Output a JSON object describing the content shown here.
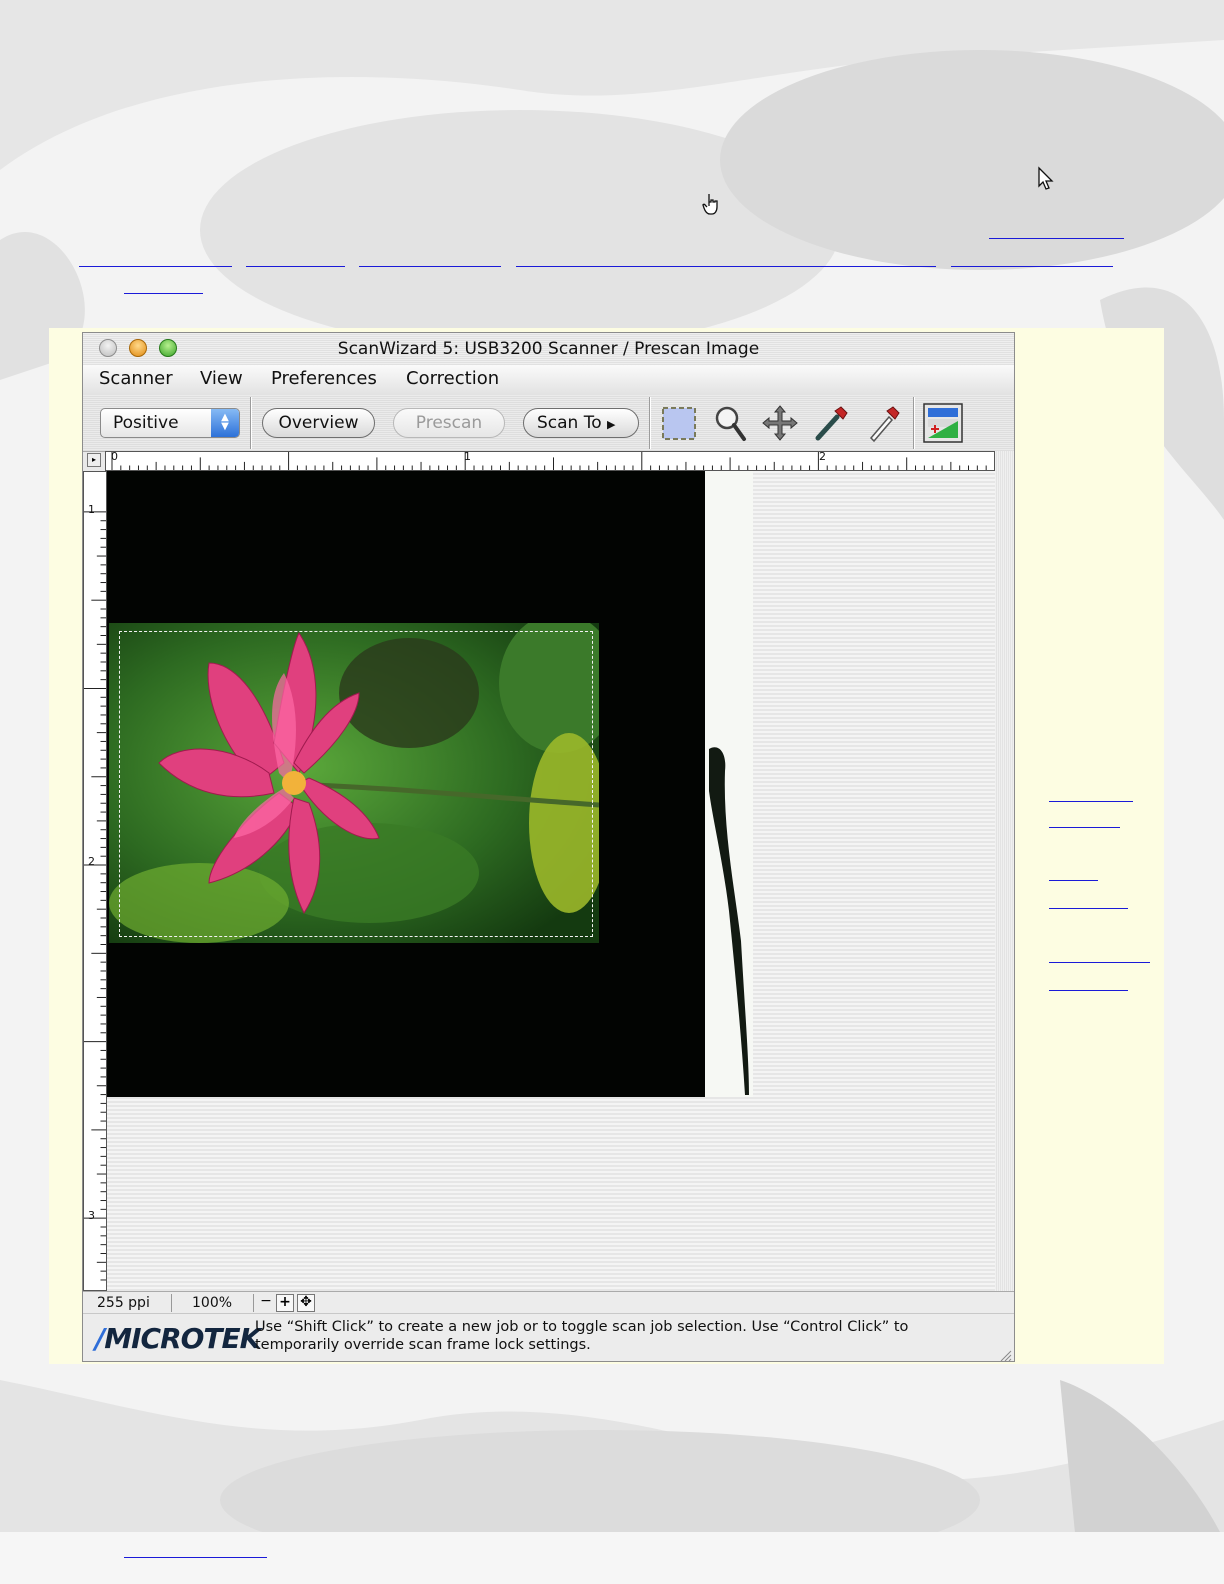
{
  "window": {
    "title": "ScanWizard 5: USB3200 Scanner / Prescan Image",
    "menus": [
      "Scanner",
      "View",
      "Preferences",
      "Correction"
    ]
  },
  "toolbar": {
    "mode_select": "Positive",
    "overview_label": "Overview",
    "prescan_label": "Prescan",
    "scan_to_label": "Scan To",
    "tools": [
      "marquee-tool-icon",
      "magnifier-icon",
      "move-icon",
      "eyedropper-icon",
      "eyedropper-empty-icon",
      "color-adjust-icon"
    ]
  },
  "rulers": {
    "horizontal_marks": [
      "0",
      "1",
      "2"
    ],
    "vertical_marks": [
      "1",
      "2",
      "3"
    ]
  },
  "status": {
    "resolution": "255 ppi",
    "zoom": "100%",
    "zoom_out": "−",
    "zoom_in": "+",
    "fit": "✥"
  },
  "footer": {
    "brand": "MICROTEK",
    "hint": "Use “Shift Click”  to create a new job or to toggle scan job selection. Use “Control Click” to temporarily override scan frame lock settings."
  },
  "colors": {
    "panel_background": "#fdfde2",
    "link_color": "#1a1ad8",
    "select_accent": "#2d71d8"
  }
}
